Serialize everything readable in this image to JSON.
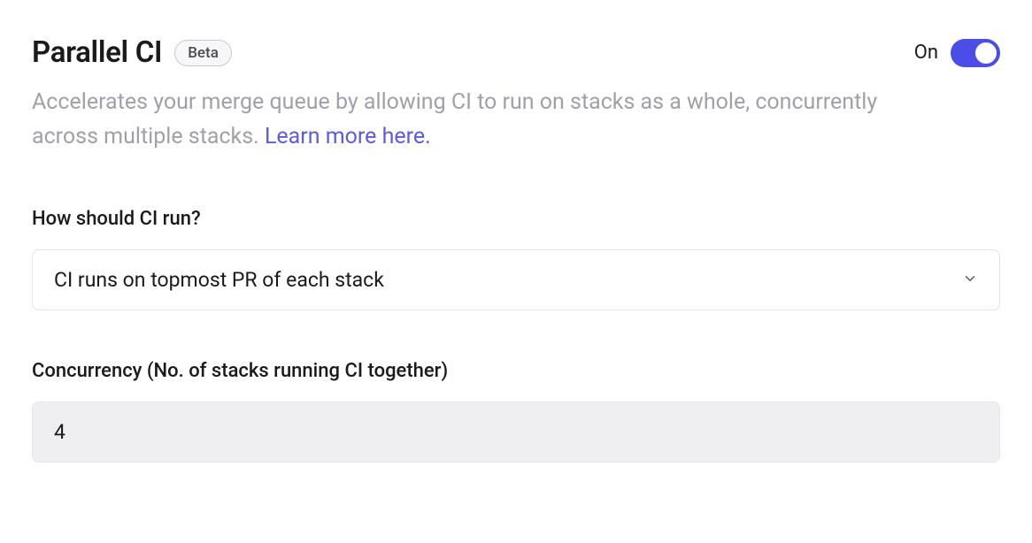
{
  "header": {
    "title": "Parallel CI",
    "badge": "Beta",
    "toggle_label": "On"
  },
  "description": {
    "text": "Accelerates your merge queue by allowing CI to run on stacks as a whole, concurrently across multiple stacks. ",
    "link_text": "Learn more here."
  },
  "fields": {
    "how_run": {
      "label": "How should CI run?",
      "selected": "CI runs on topmost PR of each stack"
    },
    "concurrency": {
      "label": "Concurrency (No. of stacks running CI together)",
      "value": "4"
    }
  }
}
